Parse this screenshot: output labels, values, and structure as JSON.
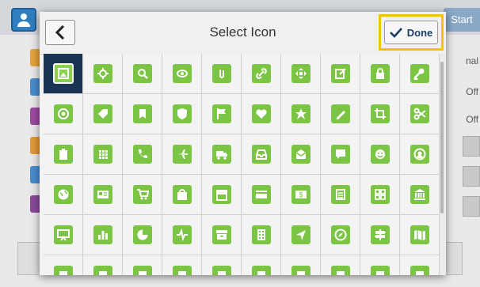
{
  "background": {
    "start_label": "Start",
    "side_labels": [
      "nal",
      "Off",
      "Off"
    ],
    "list_colors": [
      "#e6a23c",
      "#4a8ccf",
      "#9b4aa0",
      "#e39a37",
      "#4a8ccf",
      "#8a4a9b"
    ]
  },
  "dialog": {
    "title": "Select Icon",
    "back_icon": "chevron-left-icon",
    "done_label": "Done",
    "done_icon": "checkmark-icon",
    "accent_color": "#7cc444",
    "selected_color": "#1a3554",
    "highlight_color": "#f6c200",
    "selected_index": 0,
    "icons": [
      "photo-icon",
      "settings-icon",
      "search-icon",
      "eye-icon",
      "paperclip-icon",
      "link-icon",
      "move-icon",
      "edit-icon",
      "lock-icon",
      "key-icon",
      "target-icon",
      "tag-icon",
      "bookmark-icon",
      "shield-icon",
      "flag-icon",
      "heart-icon",
      "star-icon",
      "pen-icon",
      "crop-icon",
      "scissors-icon",
      "clipboard-icon",
      "grid-icon",
      "phone-icon",
      "airplane-icon",
      "truck-icon",
      "inbox-icon",
      "mail-icon",
      "chat-icon",
      "smiley-icon",
      "user-icon",
      "globe-icon",
      "id-card-icon",
      "cart-icon",
      "shopping-bag-icon",
      "store-icon",
      "credit-card-icon",
      "money-icon",
      "coins-icon",
      "calculator-icon",
      "bank-icon",
      "presentation-icon",
      "bar-chart-icon",
      "pie-chart-icon",
      "pulse-icon",
      "archive-icon",
      "building-icon",
      "navigation-icon",
      "compass-icon",
      "signpost-icon",
      "map-icon",
      "generic-icon",
      "generic-icon",
      "generic-icon",
      "generic-icon",
      "generic-icon",
      "generic-icon",
      "generic-icon",
      "generic-icon",
      "generic-icon",
      "generic-icon"
    ]
  }
}
